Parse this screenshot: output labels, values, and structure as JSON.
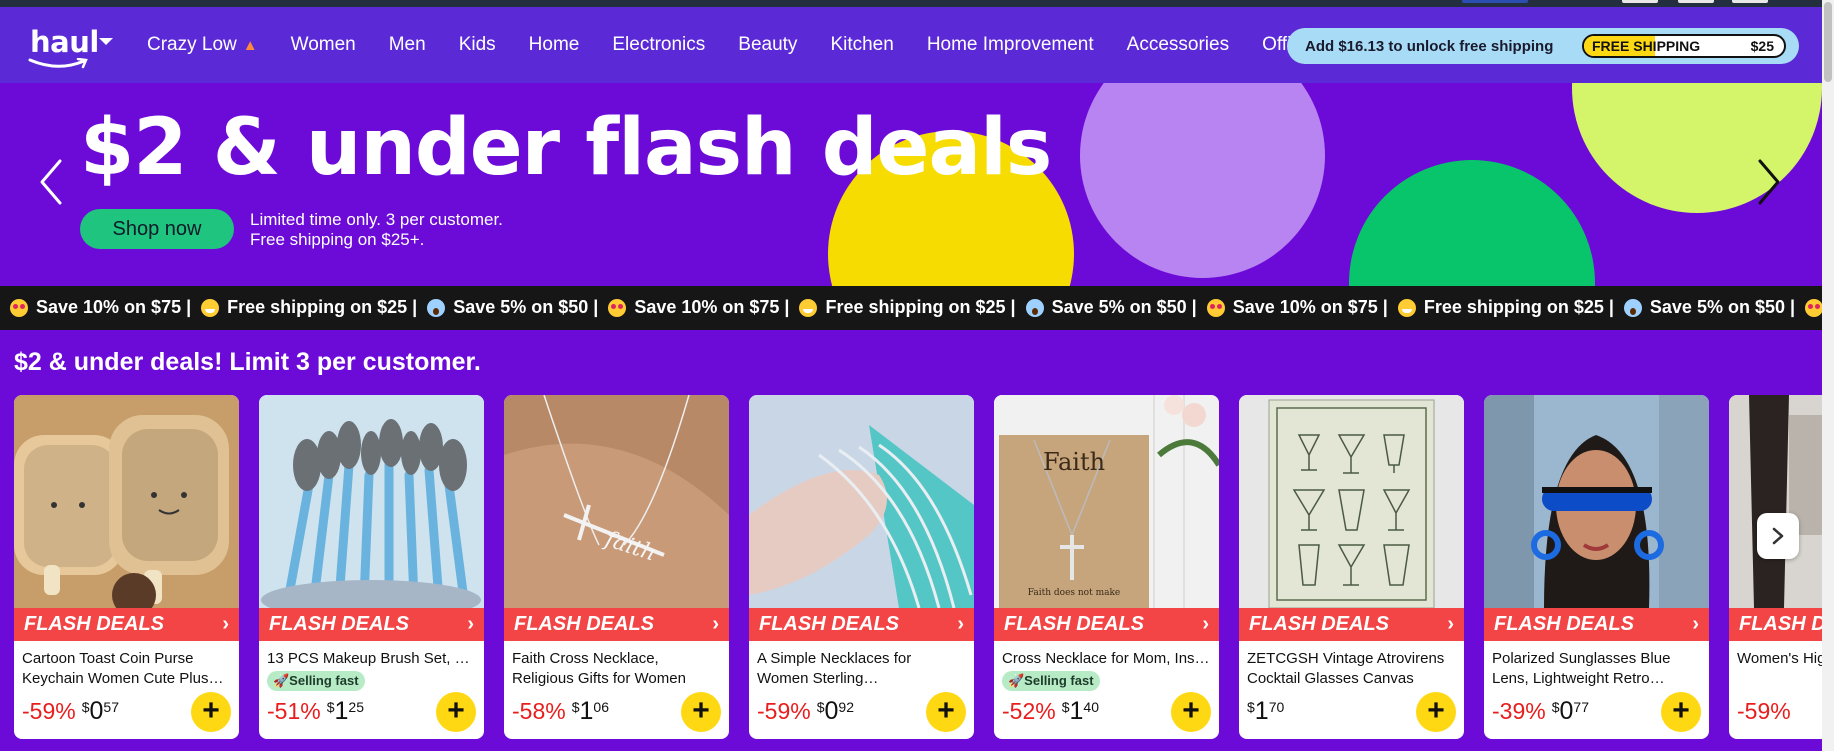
{
  "header": {
    "logo_text": "haul",
    "nav": [
      {
        "label": "Crazy Low",
        "icon": "flame-icon"
      },
      {
        "label": "Women"
      },
      {
        "label": "Men"
      },
      {
        "label": "Kids"
      },
      {
        "label": "Home"
      },
      {
        "label": "Electronics"
      },
      {
        "label": "Beauty"
      },
      {
        "label": "Kitchen"
      },
      {
        "label": "Home Improvement"
      },
      {
        "label": "Accessories"
      },
      {
        "label": "Office"
      }
    ],
    "shipping": {
      "message": "Add $16.13 to unlock free shipping",
      "label": "FREE SHIPPING",
      "threshold": "$25",
      "progress": 0.355
    }
  },
  "hero": {
    "title": "$2 & under flash deals",
    "cta": "Shop now",
    "sub_line1": "Limited time only. 3 per customer.",
    "sub_line2": "Free shipping on $25+."
  },
  "marquee": {
    "lead": ")",
    "items": [
      {
        "emoji": "heart-eyes",
        "text": "Save 10% on $75 |"
      },
      {
        "emoji": "grin",
        "text": "Free shipping on $25 |"
      },
      {
        "emoji": "scream",
        "text": "Save 5% on $50 |"
      },
      {
        "emoji": "heart-eyes",
        "text": "Save 10% on $75 |"
      },
      {
        "emoji": "grin",
        "text": "Free shipping on $25 |"
      },
      {
        "emoji": "scream",
        "text": "Save 5% on $50 |"
      },
      {
        "emoji": "heart-eyes",
        "text": "Save 10% on $75 |"
      },
      {
        "emoji": "grin",
        "text": "Free shipping on $25 |"
      },
      {
        "emoji": "scream",
        "text": "Save 5% on $50 |"
      },
      {
        "emoji": "heart-eyes",
        "text": "Sa"
      }
    ]
  },
  "section": {
    "title": "$2 & under deals! Limit 3 per customer.",
    "flash_label": "FLASH DEALS",
    "products": [
      {
        "title": "Cartoon Toast Coin Purse Keychain Women Cute Plus…",
        "badge": "",
        "discount": "-59%",
        "currency": "$",
        "whole": "0",
        "cents": "57"
      },
      {
        "title": "13 PCS Makeup Brush Set, …",
        "badge": "🚀Selling fast",
        "discount": "-51%",
        "currency": "$",
        "whole": "1",
        "cents": "25"
      },
      {
        "title": "Faith Cross Necklace, Religious Gifts for Women Christian…",
        "badge": "",
        "discount": "-58%",
        "currency": "$",
        "whole": "1",
        "cents": "06"
      },
      {
        "title": "A Simple Necklaces for Women Sterling…",
        "badge": "",
        "discount": "-59%",
        "currency": "$",
        "whole": "0",
        "cents": "92"
      },
      {
        "title": "Cross Necklace for Mom, Ins…",
        "badge": "🚀Selling fast",
        "discount": "-52%",
        "currency": "$",
        "whole": "1",
        "cents": "40"
      },
      {
        "title": "ZETCGSH Vintage Atrovirens Cocktail Glasses Canvas Wal…",
        "badge": "",
        "discount": "",
        "currency": "$",
        "whole": "1",
        "cents": "70"
      },
      {
        "title": "Polarized Sunglasses Blue Lens, Lightweight Retro…",
        "badge": "",
        "discount": "-39%",
        "currency": "$",
        "whole": "0",
        "cents": "77"
      },
      {
        "title": "Women's High Rise Yoga…",
        "badge": "",
        "discount": "-59%",
        "currency": "$",
        "whole": "",
        "cents": ""
      }
    ],
    "image_text": {
      "faith_card_title": "Faith",
      "faith_card_sub": "Faith does not make",
      "necklace_script": "faith"
    }
  },
  "colors": {
    "header_bg": "#5b2ad6",
    "hero_bg": "#6c0ad8",
    "flash_red": "#f34546",
    "add_yellow": "#ffd814",
    "price_red": "#e81d1d",
    "cta_green": "#1fc47e"
  }
}
